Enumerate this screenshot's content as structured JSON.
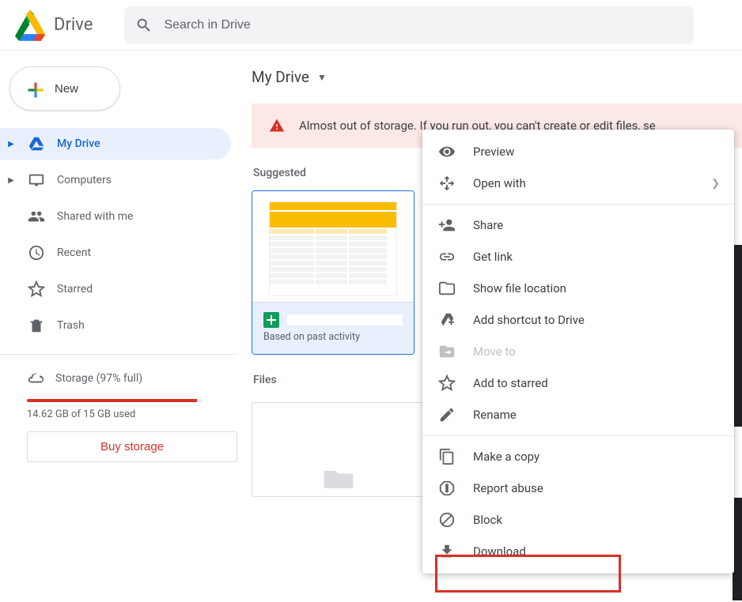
{
  "header": {
    "title": "Drive",
    "search_placeholder": "Search in Drive"
  },
  "sidebar": {
    "new_label": "New",
    "items": [
      {
        "label": "My Drive"
      },
      {
        "label": "Computers"
      },
      {
        "label": "Shared with me"
      },
      {
        "label": "Recent"
      },
      {
        "label": "Starred"
      },
      {
        "label": "Trash"
      }
    ],
    "storage_label": "Storage (97% full)",
    "storage_used": "14.62 GB of 15 GB used",
    "buy_label": "Buy storage"
  },
  "main": {
    "breadcrumb": "My Drive",
    "warning_text": "Almost out of storage. If you run out, you can't create or edit files, se",
    "suggested_label": "Suggested",
    "card_subtext": "Based on past activity",
    "files_label": "Files"
  },
  "menu": {
    "preview": "Preview",
    "open_with": "Open with",
    "share": "Share",
    "get_link": "Get link",
    "show_location": "Show file location",
    "add_shortcut": "Add shortcut to Drive",
    "move_to": "Move to",
    "add_starred": "Add to starred",
    "rename": "Rename",
    "make_copy": "Make a copy",
    "report_abuse": "Report abuse",
    "block": "Block",
    "download": "Download"
  }
}
